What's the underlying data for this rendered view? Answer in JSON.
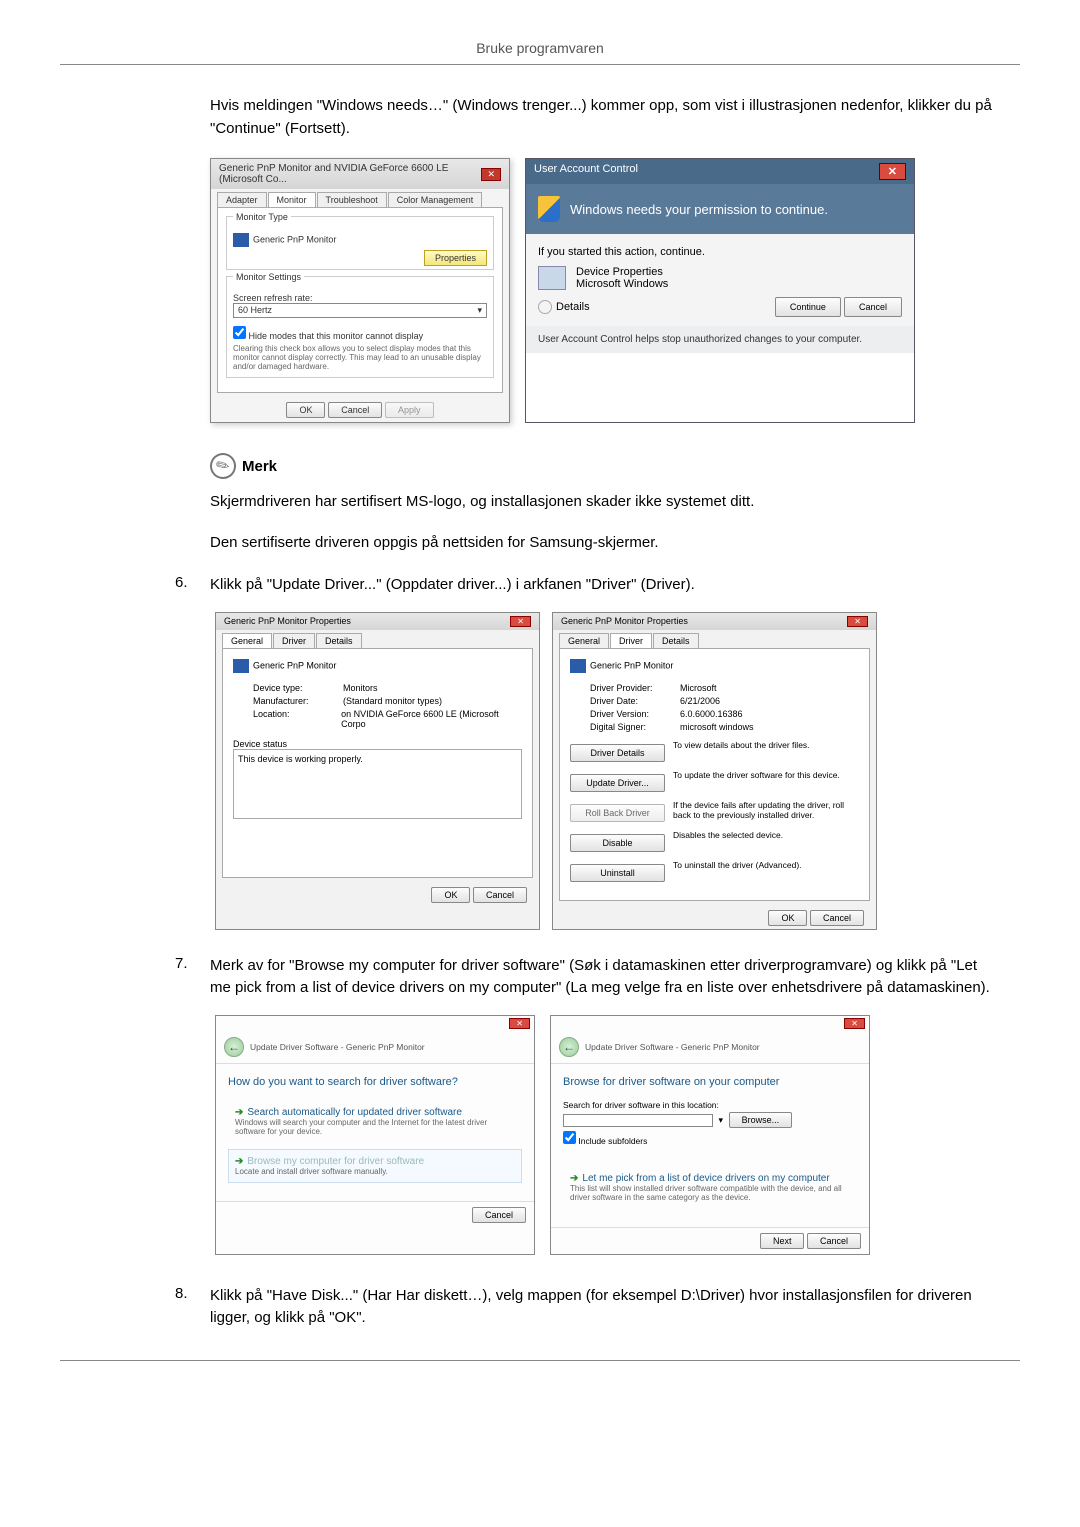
{
  "header": {
    "title": "Bruke programvaren"
  },
  "intro": "Hvis meldingen \"Windows needs…\" (Windows trenger...) kommer opp, som vist i illustrasjonen nedenfor, klikker du på \"Continue\" (Fortsett).",
  "dialog1": {
    "title": "Generic PnP Monitor and NVIDIA GeForce 6600 LE (Microsoft Co...",
    "tabs": {
      "adapter": "Adapter",
      "monitor": "Monitor",
      "troubleshoot": "Troubleshoot",
      "color": "Color Management"
    },
    "monitorType": "Monitor Type",
    "monitorName": "Generic PnP Monitor",
    "propertiesBtn": "Properties",
    "monitorSettings": "Monitor Settings",
    "refreshLabel": "Screen refresh rate:",
    "refreshValue": "60 Hertz",
    "hideModes": "Hide modes that this monitor cannot display",
    "hideModesDesc": "Clearing this check box allows you to select display modes that this monitor cannot display correctly. This may lead to an unusable display and/or damaged hardware.",
    "ok": "OK",
    "cancel": "Cancel",
    "apply": "Apply"
  },
  "uac": {
    "title": "User Account Control",
    "banner": "Windows needs your permission to continue.",
    "startedAction": "If you started this action, continue.",
    "device": "Device Properties",
    "win": "Microsoft Windows",
    "details": "Details",
    "continue": "Continue",
    "cancel": "Cancel",
    "footer": "User Account Control helps stop unauthorized changes to your computer."
  },
  "note": {
    "title": "Merk",
    "line1": "Skjermdriveren har sertifisert MS-logo, og installasjonen skader ikke systemet ditt.",
    "line2": "Den sertifiserte driveren oppgis på nettsiden for Samsung-skjermer."
  },
  "step6": {
    "num": "6.",
    "text": "Klikk på \"Update Driver...\" (Oppdater driver...) i arkfanen \"Driver\" (Driver)."
  },
  "propsA": {
    "title": "Generic PnP Monitor Properties",
    "tabs": {
      "general": "General",
      "driver": "Driver",
      "details": "Details"
    },
    "monitorName": "Generic PnP Monitor",
    "deviceTypeLabel": "Device type:",
    "deviceType": "Monitors",
    "manufacturerLabel": "Manufacturer:",
    "manufacturer": "(Standard monitor types)",
    "locationLabel": "Location:",
    "location": "on NVIDIA GeForce 6600 LE (Microsoft Corpo",
    "deviceStatus": "Device status",
    "statusText": "This device is working properly.",
    "ok": "OK",
    "cancel": "Cancel"
  },
  "propsB": {
    "title": "Generic PnP Monitor Properties",
    "tabs": {
      "general": "General",
      "driver": "Driver",
      "details": "Details"
    },
    "monitorName": "Generic PnP Monitor",
    "providerLabel": "Driver Provider:",
    "provider": "Microsoft",
    "dateLabel": "Driver Date:",
    "date": "6/21/2006",
    "versionLabel": "Driver Version:",
    "version": "6.0.6000.16386",
    "signerLabel": "Digital Signer:",
    "signer": "microsoft windows",
    "driverDetails": "Driver Details",
    "driverDetailsDesc": "To view details about the driver files.",
    "updateDriver": "Update Driver...",
    "updateDriverDesc": "To update the driver software for this device.",
    "rollBack": "Roll Back Driver",
    "rollBackDesc": "If the device fails after updating the driver, roll back to the previously installed driver.",
    "disable": "Disable",
    "disableDesc": "Disables the selected device.",
    "uninstall": "Uninstall",
    "uninstallDesc": "To uninstall the driver (Advanced).",
    "ok": "OK",
    "cancel": "Cancel"
  },
  "step7": {
    "num": "7.",
    "text": "Merk av for \"Browse my computer for driver software\" (Søk i datamaskinen etter driverprogramvare) og klikk på \"Let me pick from a list of device drivers on my computer\" (La meg velge fra en liste over enhetsdrivere på datamaskinen)."
  },
  "wizardA": {
    "crumb": "Update Driver Software - Generic PnP Monitor",
    "heading": "How do you want to search for driver software?",
    "opt1": "Search automatically for updated driver software",
    "opt1desc": "Windows will search your computer and the Internet for the latest driver software for your device.",
    "opt2": "Browse my computer for driver software",
    "opt2desc": "Locate and install driver software manually.",
    "cancel": "Cancel"
  },
  "wizardB": {
    "crumb": "Update Driver Software - Generic PnP Monitor",
    "heading": "Browse for driver software on your computer",
    "searchLabel": "Search for driver software in this location:",
    "browse": "Browse...",
    "includeSub": "Include subfolders",
    "opt": "Let me pick from a list of device drivers on my computer",
    "optDesc": "This list will show installed driver software compatible with the device, and all driver software in the same category as the device.",
    "next": "Next",
    "cancel": "Cancel"
  },
  "step8": {
    "num": "8.",
    "text": "Klikk på \"Have Disk...\" (Har Har diskett…), velg mappen (for eksempel D:\\Driver) hvor installasjonsfilen for driveren ligger, og klikk på \"OK\"."
  }
}
